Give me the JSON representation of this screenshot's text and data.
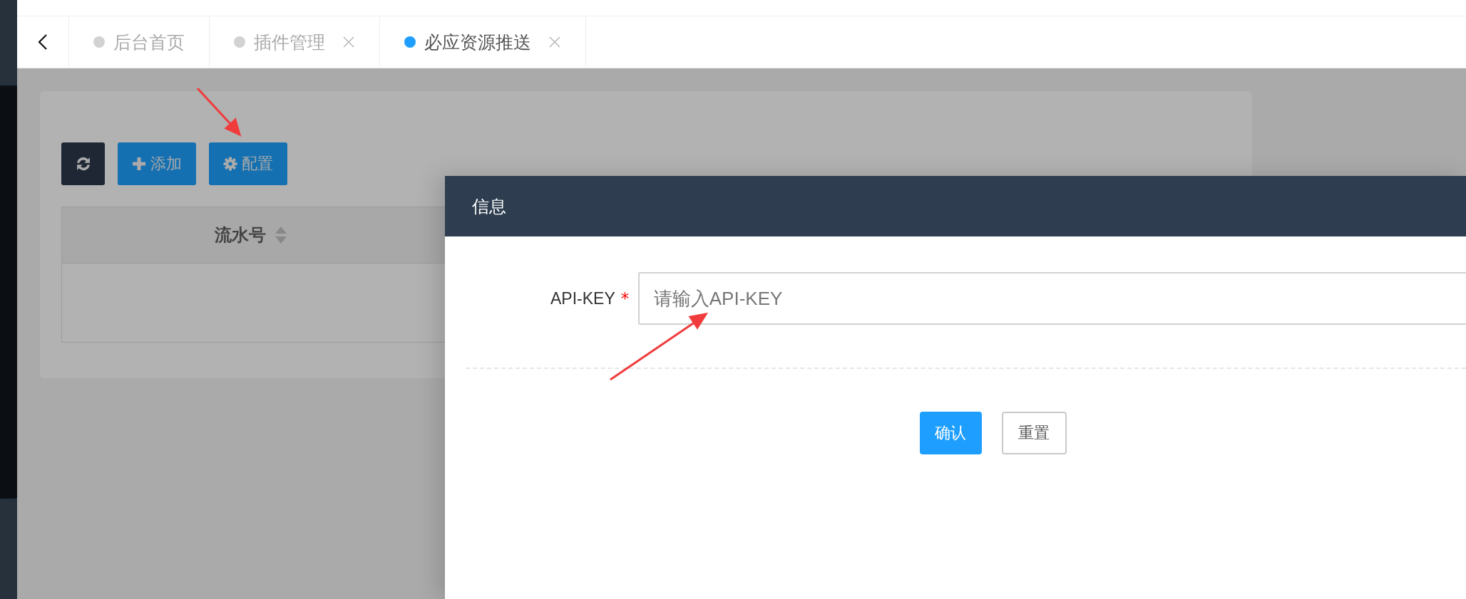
{
  "tabs": [
    {
      "label": "后台首页",
      "selected": false,
      "closable": false
    },
    {
      "label": "插件管理",
      "selected": false,
      "closable": true
    },
    {
      "label": "必应资源推送",
      "selected": true,
      "closable": true
    }
  ],
  "toolbar": {
    "buttons": [
      {
        "kind": "refresh"
      },
      {
        "kind": "add",
        "label": "添加"
      },
      {
        "kind": "config",
        "label": "配置"
      }
    ]
  },
  "table": {
    "columns": [
      {
        "label": "流水号",
        "sortable": true
      }
    ]
  },
  "dialog": {
    "title": "信息",
    "fields": [
      {
        "label": "API-KEY",
        "required": true,
        "required_mark": "*",
        "placeholder": "请输入API-KEY"
      }
    ],
    "buttons": [
      {
        "label": "确认",
        "kind": "primary"
      },
      {
        "label": "重置",
        "kind": "default"
      }
    ]
  }
}
